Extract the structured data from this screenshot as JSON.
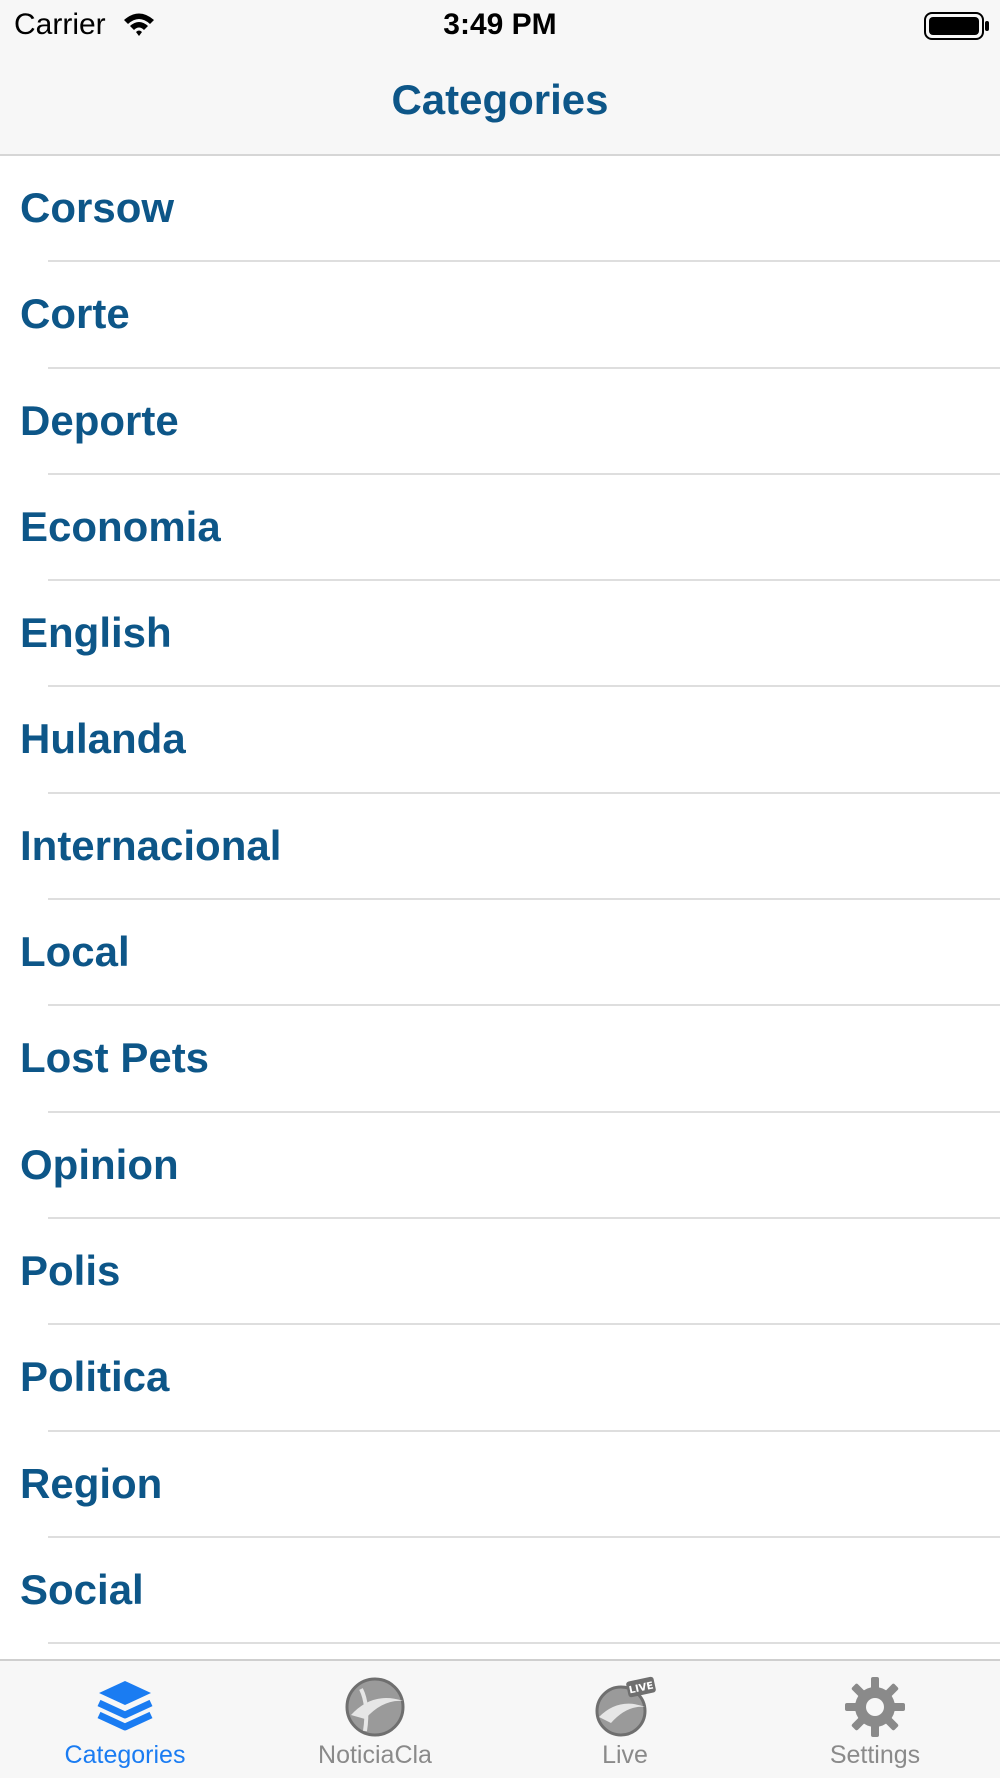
{
  "status_bar": {
    "carrier": "Carrier",
    "time": "3:49 PM"
  },
  "nav": {
    "title": "Categories"
  },
  "categories": [
    {
      "label": "Corsow"
    },
    {
      "label": "Corte"
    },
    {
      "label": "Deporte"
    },
    {
      "label": "Economia"
    },
    {
      "label": "English"
    },
    {
      "label": "Hulanda"
    },
    {
      "label": "Internacional"
    },
    {
      "label": "Local"
    },
    {
      "label": "Lost Pets"
    },
    {
      "label": "Opinion"
    },
    {
      "label": "Polis"
    },
    {
      "label": "Politica"
    },
    {
      "label": "Region"
    },
    {
      "label": "Social"
    }
  ],
  "tabs": [
    {
      "label": "Categories",
      "icon": "stacked-layers-icon",
      "active": true
    },
    {
      "label": "NoticiaCla",
      "icon": "globe-logo-icon",
      "active": false
    },
    {
      "label": "Live",
      "icon": "live-globe-icon",
      "active": false
    },
    {
      "label": "Settings",
      "icon": "gear-icon",
      "active": false
    }
  ],
  "colors": {
    "accent": "#0d5688",
    "tab_active": "#1a7cf2",
    "tab_inactive": "#8a8a8a",
    "bar_background": "#f7f7f7"
  }
}
